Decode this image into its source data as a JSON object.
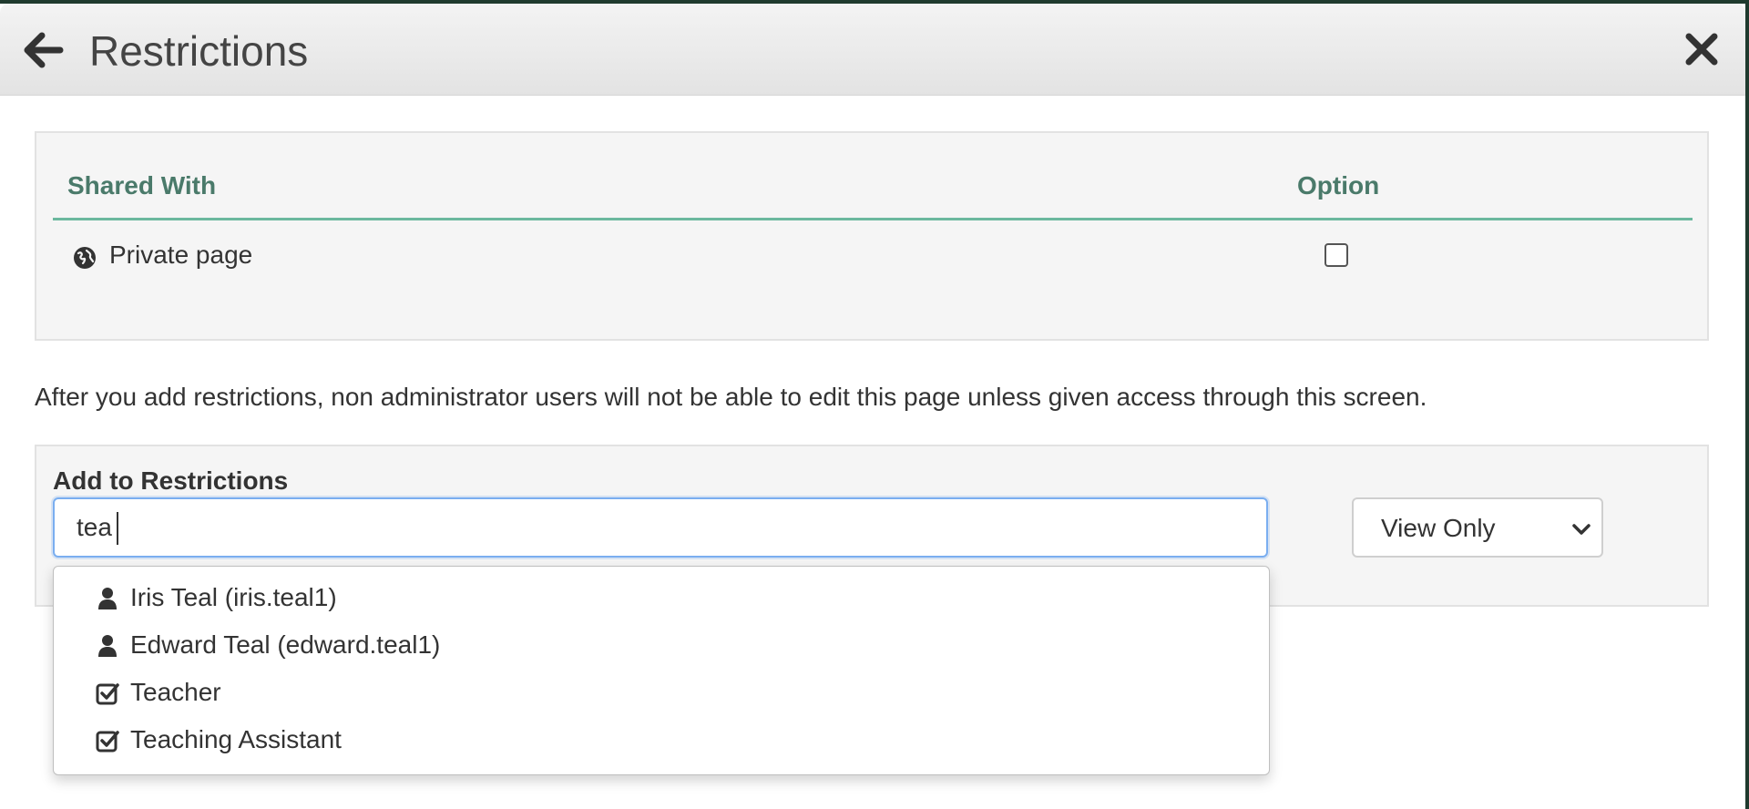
{
  "header": {
    "title": "Restrictions",
    "back_icon": "arrow-left-icon",
    "close_icon": "close-icon"
  },
  "shared_table": {
    "columns": [
      "Shared With",
      "Option"
    ],
    "rows": [
      {
        "icon": "globe-icon",
        "label": "Private page",
        "checked": false
      }
    ]
  },
  "notice": "After you add restrictions, non administrator users will not be able to edit this page unless given access through this screen.",
  "add_restrictions": {
    "label": "Add to Restrictions",
    "search_value": "tea",
    "permission_selected": "View Only"
  },
  "suggestions": [
    {
      "icon": "user-icon",
      "label": "Iris Teal (iris.teal1)"
    },
    {
      "icon": "user-icon",
      "label": "Edward Teal (edward.teal1)"
    },
    {
      "icon": "checkbox-icon",
      "label": "Teacher"
    },
    {
      "icon": "checkbox-icon",
      "label": "Teaching Assistant"
    }
  ],
  "colors": {
    "accent": "#4a7a6a",
    "rule": "#6bb89e",
    "focus": "#7aaef0"
  }
}
